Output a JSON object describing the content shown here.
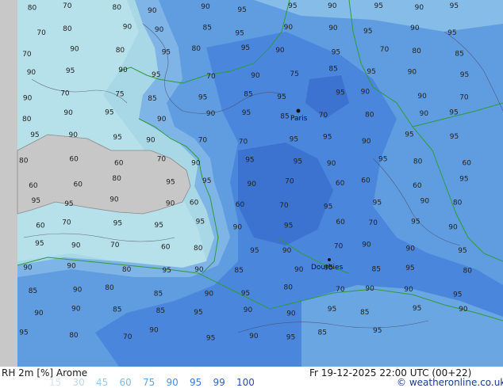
{
  "map": {
    "contour_labels": [
      {
        "t": "80"
      },
      {
        "t": "70"
      },
      {
        "t": "80"
      },
      {
        "t": "90"
      },
      {
        "t": "90"
      },
      {
        "t": "95"
      },
      {
        "t": "95"
      },
      {
        "t": "90"
      },
      {
        "t": "95"
      },
      {
        "t": "90"
      },
      {
        "t": "95"
      },
      {
        "t": "70"
      },
      {
        "t": "80"
      },
      {
        "t": "90"
      },
      {
        "t": "90"
      },
      {
        "t": "85"
      },
      {
        "t": "95"
      },
      {
        "t": "90"
      },
      {
        "t": "90"
      },
      {
        "t": "95"
      },
      {
        "t": "90"
      },
      {
        "t": "95"
      },
      {
        "t": "70"
      },
      {
        "t": "90"
      },
      {
        "t": "80"
      },
      {
        "t": "95"
      },
      {
        "t": "80"
      },
      {
        "t": "95"
      },
      {
        "t": "90"
      },
      {
        "t": "95"
      },
      {
        "t": "70"
      },
      {
        "t": "80"
      },
      {
        "t": "85"
      },
      {
        "t": "90"
      },
      {
        "t": "95"
      },
      {
        "t": "90"
      },
      {
        "t": "95"
      },
      {
        "t": "70"
      },
      {
        "t": "90"
      },
      {
        "t": "75"
      },
      {
        "t": "85"
      },
      {
        "t": "95"
      },
      {
        "t": "90"
      },
      {
        "t": "95"
      },
      {
        "t": "90"
      },
      {
        "t": "70"
      },
      {
        "t": "75"
      },
      {
        "t": "85"
      },
      {
        "t": "95"
      },
      {
        "t": "85"
      },
      {
        "t": "95"
      },
      {
        "t": "95"
      },
      {
        "t": "90"
      },
      {
        "t": "90"
      },
      {
        "t": "70"
      },
      {
        "t": "80"
      },
      {
        "t": "90"
      },
      {
        "t": "95"
      },
      {
        "t": "90"
      },
      {
        "t": "90"
      },
      {
        "t": "95"
      },
      {
        "t": "85"
      },
      {
        "t": "70"
      },
      {
        "t": "80"
      },
      {
        "t": "90"
      },
      {
        "t": "95"
      },
      {
        "t": "95"
      },
      {
        "t": "90"
      },
      {
        "t": "95"
      },
      {
        "t": "90"
      },
      {
        "t": "70"
      },
      {
        "t": "70"
      },
      {
        "t": "95"
      },
      {
        "t": "95"
      },
      {
        "t": "90"
      },
      {
        "t": "95"
      },
      {
        "t": "95"
      },
      {
        "t": "80"
      },
      {
        "t": "60"
      },
      {
        "t": "60"
      },
      {
        "t": "70"
      },
      {
        "t": "90"
      },
      {
        "t": "95"
      },
      {
        "t": "95"
      },
      {
        "t": "90"
      },
      {
        "t": "95"
      },
      {
        "t": "80"
      },
      {
        "t": "60"
      },
      {
        "t": "60"
      },
      {
        "t": "60"
      },
      {
        "t": "80"
      },
      {
        "t": "95"
      },
      {
        "t": "95"
      },
      {
        "t": "90"
      },
      {
        "t": "70"
      },
      {
        "t": "60"
      },
      {
        "t": "60"
      },
      {
        "t": "60"
      },
      {
        "t": "95"
      },
      {
        "t": "95"
      },
      {
        "t": "95"
      },
      {
        "t": "90"
      },
      {
        "t": "90"
      },
      {
        "t": "60"
      },
      {
        "t": "60"
      },
      {
        "t": "70"
      },
      {
        "t": "95"
      },
      {
        "t": "95"
      },
      {
        "t": "90"
      },
      {
        "t": "80"
      },
      {
        "t": "60"
      },
      {
        "t": "70"
      },
      {
        "t": "95"
      },
      {
        "t": "95"
      },
      {
        "t": "95"
      },
      {
        "t": "90"
      },
      {
        "t": "95"
      },
      {
        "t": "60"
      },
      {
        "t": "70"
      },
      {
        "t": "95"
      },
      {
        "t": "90"
      },
      {
        "t": "95"
      },
      {
        "t": "90"
      },
      {
        "t": "70"
      },
      {
        "t": "60"
      },
      {
        "t": "80"
      },
      {
        "t": "95"
      },
      {
        "t": "90"
      },
      {
        "t": "70"
      },
      {
        "t": "90"
      },
      {
        "t": "90"
      },
      {
        "t": "95"
      },
      {
        "t": "90"
      },
      {
        "t": "90"
      },
      {
        "t": "80"
      },
      {
        "t": "95"
      },
      {
        "t": "90"
      },
      {
        "t": "85"
      },
      {
        "t": "90"
      },
      {
        "t": "95"
      },
      {
        "t": "85"
      },
      {
        "t": "95"
      },
      {
        "t": "80"
      },
      {
        "t": "85"
      },
      {
        "t": "90"
      },
      {
        "t": "80"
      },
      {
        "t": "85"
      },
      {
        "t": "90"
      },
      {
        "t": "95"
      },
      {
        "t": "80"
      },
      {
        "t": "70"
      },
      {
        "t": "90"
      },
      {
        "t": "90"
      },
      {
        "t": "95"
      },
      {
        "t": "90"
      },
      {
        "t": "90"
      },
      {
        "t": "85"
      },
      {
        "t": "85"
      },
      {
        "t": "95"
      },
      {
        "t": "90"
      },
      {
        "t": "90"
      },
      {
        "t": "95"
      },
      {
        "t": "85"
      },
      {
        "t": "95"
      },
      {
        "t": "90"
      },
      {
        "t": "95"
      },
      {
        "t": "80"
      },
      {
        "t": "70"
      },
      {
        "t": "90"
      },
      {
        "t": "95"
      },
      {
        "t": "90"
      },
      {
        "t": "95"
      },
      {
        "t": "85"
      },
      {
        "t": "95"
      }
    ],
    "cities": [
      {
        "name": "Paris"
      },
      {
        "name": "Dourbies"
      }
    ]
  },
  "footer": {
    "title": "RH 2m [%] Arome",
    "datetime": "Fr 19-12-2025 22:00 UTC (00+22)",
    "credit": "© weatheronline.co.uk",
    "legend": [
      {
        "v": "15",
        "c": "#d3e6f2"
      },
      {
        "v": "30",
        "c": "#bdd7ea"
      },
      {
        "v": "45",
        "c": "#9fc9e8"
      },
      {
        "v": "60",
        "c": "#7fb8e8"
      },
      {
        "v": "75",
        "c": "#62a3e8"
      },
      {
        "v": "90",
        "c": "#4a8fe6"
      },
      {
        "v": "95",
        "c": "#3a78d8"
      },
      {
        "v": "99",
        "c": "#2f63c4"
      },
      {
        "v": "100",
        "c": "#2450b0"
      }
    ]
  }
}
